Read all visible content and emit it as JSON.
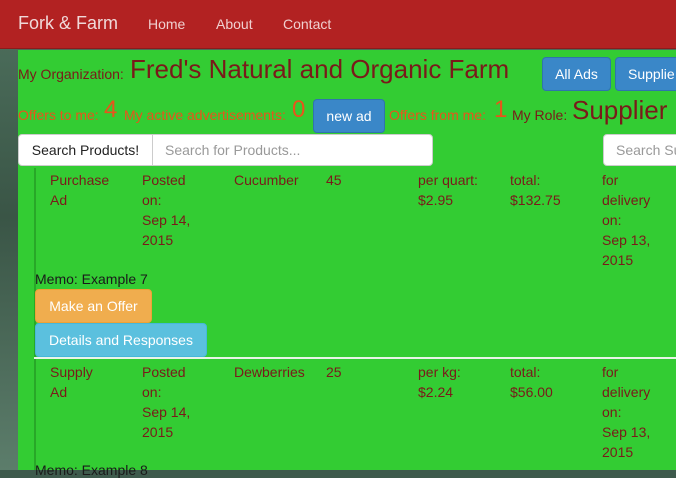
{
  "navbar": {
    "brand": "Fork & Farm",
    "links": [
      "Home",
      "About",
      "Contact"
    ],
    "color": "#b22222"
  },
  "header": {
    "org_label": "My Organization:",
    "org_name": "Fred's Natural and Organic Farm",
    "all_ads_button": "All Ads",
    "supplier_button": "Supplie",
    "offers_to_me_label": "Offers to me:",
    "offers_to_me_count": "4",
    "active_ads_label": "My active advertisements:",
    "active_ads_count": "0",
    "new_ad_button": "new ad",
    "offers_from_me_label": "Offers from me:",
    "offers_from_me_count": "1",
    "role_label": "My Role:",
    "role_value": "Supplier"
  },
  "search": {
    "products_button": "Search Products!",
    "products_placeholder": "Search for Products...",
    "second_placeholder": "Search Su"
  },
  "ads": [
    {
      "type_line1": "Purchase",
      "type_line2": "Ad",
      "posted_lines": [
        "Posted",
        "on:",
        "Sep 14,",
        "2015"
      ],
      "product": "Cucumber",
      "quantity": "45",
      "unit_line1": "per quart:",
      "unit_line2": "$2.95",
      "total_line1": "total:",
      "total_line2": "$132.75",
      "delivery_lines": [
        "for",
        "delivery",
        "on:",
        "Sep 13,",
        "2015"
      ],
      "memo": "Memo: Example 7",
      "offer_button": "Make an Offer",
      "details_button": "Details and Responses"
    },
    {
      "type_line1": "Supply",
      "type_line2": "Ad",
      "posted_lines": [
        "Posted",
        "on:",
        "Sep 14,",
        "2015"
      ],
      "product": "Dewberries",
      "quantity": "25",
      "unit_line1": "per kg:",
      "unit_line2": "$2.24",
      "total_line1": "total:",
      "total_line2": "$56.00",
      "delivery_lines": [
        "for",
        "delivery",
        "on:",
        "Sep 13,",
        "2015"
      ],
      "memo": "Memo: Example 8"
    }
  ]
}
